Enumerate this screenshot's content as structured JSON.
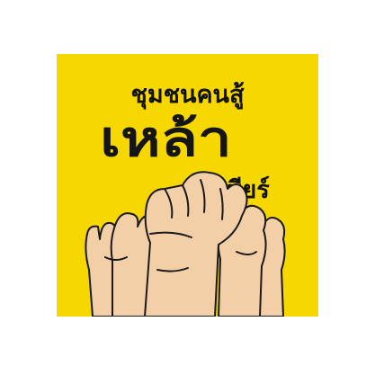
{
  "poster": {
    "background": "#f6d800",
    "line_1": "ชุมชนคนสู้",
    "line_2": "เหล้า",
    "line_3": "เบียร์"
  },
  "illustration": {
    "skin": "#f3cfa8",
    "outline": "#1a1a1a",
    "icon": "raised-fists-icon"
  }
}
